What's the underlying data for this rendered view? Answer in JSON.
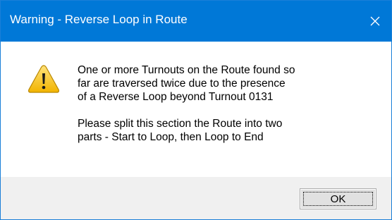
{
  "window": {
    "title": "Warning - Reverse Loop in Route",
    "close_glyph": "✕",
    "accent_color": "#0078d7"
  },
  "icon": {
    "name": "warning-icon",
    "glyph": "!"
  },
  "message": {
    "lines": [
      "One or more Turnouts on the Route found so",
      "far are traversed twice due to the presence",
      "of a Reverse Loop beyond Turnout 0131",
      "",
      "Please split this section the Route into two",
      "parts - Start to Loop, then Loop to End"
    ]
  },
  "buttons": {
    "ok_label": "OK"
  }
}
